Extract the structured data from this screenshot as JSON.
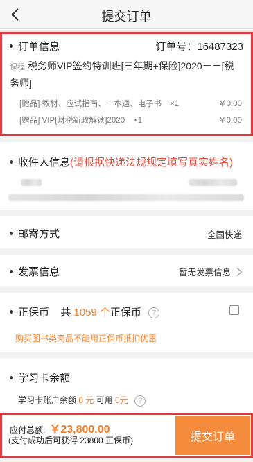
{
  "header": {
    "title": "提交订单"
  },
  "order": {
    "section_title": "订单信息",
    "order_no_label": "订单号：",
    "order_no": "16487323",
    "course_tag": "课程",
    "course_name": "税务师VIP签约特训班[三年期+保险]2020－－[税务师]",
    "gifts": [
      {
        "name": "[赠品] 教材、应试指南、一本通、电子书",
        "qty": "×1",
        "price": "￥0.00"
      },
      {
        "name": "[赠品] VIP[财税新政解读]2020",
        "qty": "×1",
        "price": "￥0.00"
      }
    ]
  },
  "recipient": {
    "title": "收件人信息",
    "warning": "(请根据快递法规规定填写真实姓名)"
  },
  "mail": {
    "label": "邮寄方式",
    "value": "全国快递"
  },
  "invoice": {
    "label": "发票信息",
    "value": "暂无发票信息"
  },
  "coin": {
    "label": "正保币",
    "count_prefix": "共",
    "count": "1059 个",
    "count_suffix": "正保币",
    "note": "购买图书类商品不能用正保币抵扣优惠"
  },
  "card_balance": {
    "label": "学习卡余额",
    "line_prefix": "学习卡账户余额",
    "balance": "0 元",
    "available_label": "可用",
    "available": "0元"
  },
  "footer": {
    "total_label": "应付总额:",
    "total_amount": "￥23,800.00",
    "coin_note": "(支付成功后可获得 23800 正保币)",
    "submit_label": "提交订单"
  },
  "colors": {
    "accent": "#f58b3c",
    "warning": "#e34b3c",
    "highlight_outline": "#e0393b"
  }
}
